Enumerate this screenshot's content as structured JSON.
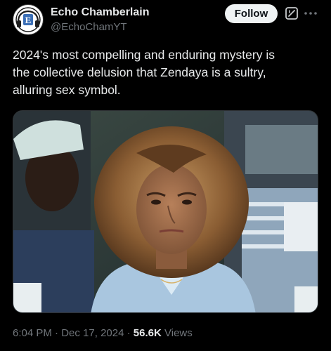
{
  "author": {
    "display_name": "Echo Chamberlain",
    "handle": "@EchoChamYT",
    "avatar_letter": "E"
  },
  "actions": {
    "follow_label": "Follow",
    "grok_icon": "grok-icon",
    "more_icon": "more-icon"
  },
  "tweet": {
    "text": "2024's most compelling and enduring mystery is\nthe collective delusion that Zendaya is a sultry,\nalluring sex symbol."
  },
  "meta": {
    "time": "6:04 PM",
    "separator": "·",
    "date": "Dec 17, 2024",
    "views_count": "56.6K",
    "views_label": "Views"
  },
  "colors": {
    "background": "#000000",
    "text_primary": "#e7e9ea",
    "text_secondary": "#71767b",
    "follow_bg": "#eff3f4"
  }
}
